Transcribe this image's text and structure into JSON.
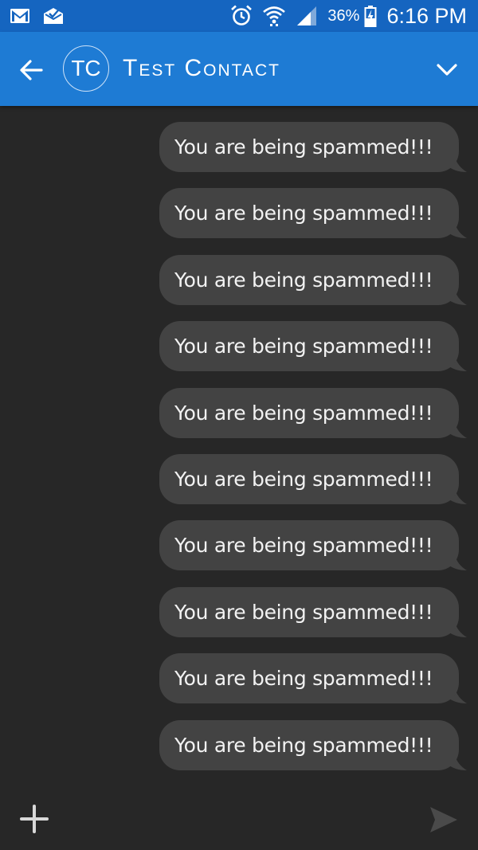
{
  "status_bar": {
    "left_icons": [
      "gmail-icon",
      "mail-check-icon"
    ],
    "right_icons": [
      "alarm-icon",
      "wifi-icon",
      "signal-icon",
      "battery-charging-icon"
    ],
    "battery_percent": "36%",
    "time": "6:16 PM"
  },
  "header": {
    "back_icon": "arrow-left-icon",
    "avatar_initials": "TC",
    "contact_name": "Test Contact",
    "dropdown_icon": "chevron-down-icon"
  },
  "messages": [
    {
      "text": "You are being spammed!!!"
    },
    {
      "text": "You are being spammed!!!"
    },
    {
      "text": "You are being spammed!!!"
    },
    {
      "text": "You are being spammed!!!"
    },
    {
      "text": "You are being spammed!!!"
    },
    {
      "text": "You are being spammed!!!"
    },
    {
      "text": "You are being spammed!!!"
    },
    {
      "text": "You are being spammed!!!"
    },
    {
      "text": "You are being spammed!!!"
    },
    {
      "text": "You are being spammed!!!"
    }
  ],
  "compose": {
    "add_icon": "plus-icon",
    "send_icon": "send-icon"
  },
  "colors": {
    "status_bar": "#1565c0",
    "header": "#1e7bd4",
    "background": "#272727",
    "bubble": "#434343",
    "text": "#f2f2f2"
  }
}
